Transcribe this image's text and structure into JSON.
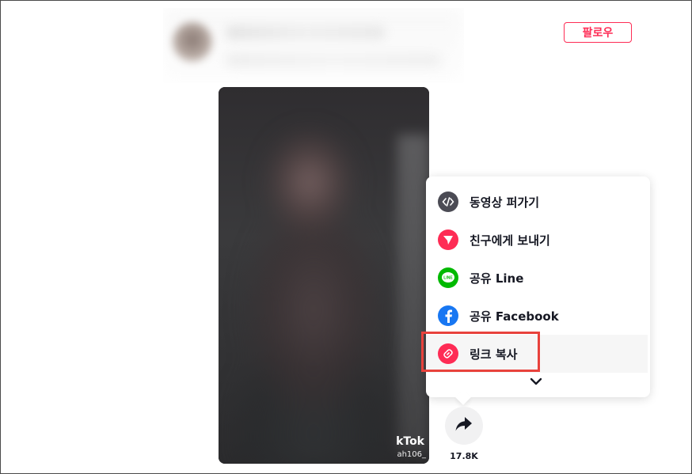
{
  "header": {
    "follow_label": "팔로우"
  },
  "video": {
    "watermark": "kTok",
    "watermark_user": "ah106_"
  },
  "share_menu": {
    "items": [
      {
        "label": "동영상 퍼가기",
        "icon": "embed-code-icon",
        "color": "#4b4b54"
      },
      {
        "label": "친구에게 보내기",
        "icon": "send-icon",
        "color": "#fe2c55"
      },
      {
        "label": "공유 Line",
        "icon": "line-icon",
        "color": "#00b900"
      },
      {
        "label": "공유 Facebook",
        "icon": "facebook-icon",
        "color": "#1877f2"
      },
      {
        "label": "링크 복사",
        "icon": "link-icon",
        "color": "#fe2c55"
      }
    ],
    "more_icon": "chevron-down-icon"
  },
  "share": {
    "count": "17.8K",
    "icon": "share-arrow-icon"
  },
  "colors": {
    "accent": "#fe2c55",
    "highlight": "#e8423c"
  }
}
